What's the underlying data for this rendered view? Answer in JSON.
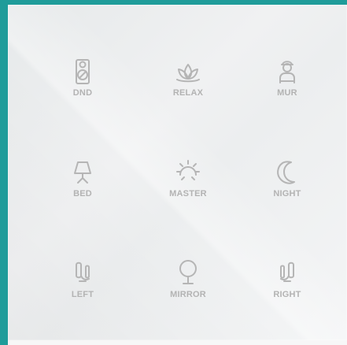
{
  "buttons": [
    {
      "key": "dnd",
      "label": "DND",
      "icon": "do-not-disturb-door-hanger-icon"
    },
    {
      "key": "relax",
      "label": "RELAX",
      "icon": "lotus-icon"
    },
    {
      "key": "mur",
      "label": "MUR",
      "icon": "housekeeping-person-icon"
    },
    {
      "key": "bed",
      "label": "BED",
      "icon": "bed-lamp-icon"
    },
    {
      "key": "master",
      "label": "MASTER",
      "icon": "sun-icon"
    },
    {
      "key": "night",
      "label": "NIGHT",
      "icon": "moon-icon"
    },
    {
      "key": "left",
      "label": "LEFT",
      "icon": "wall-sconce-left-icon"
    },
    {
      "key": "mirror",
      "label": "MIRROR",
      "icon": "mirror-icon"
    },
    {
      "key": "right",
      "label": "RIGHT",
      "icon": "wall-sconce-right-icon"
    }
  ],
  "colors": {
    "accent_border": "#1f9c9a",
    "icon_gray": "#b5b5b5",
    "text_gray": "#b3b3b3",
    "panel": "#eef0f1"
  }
}
